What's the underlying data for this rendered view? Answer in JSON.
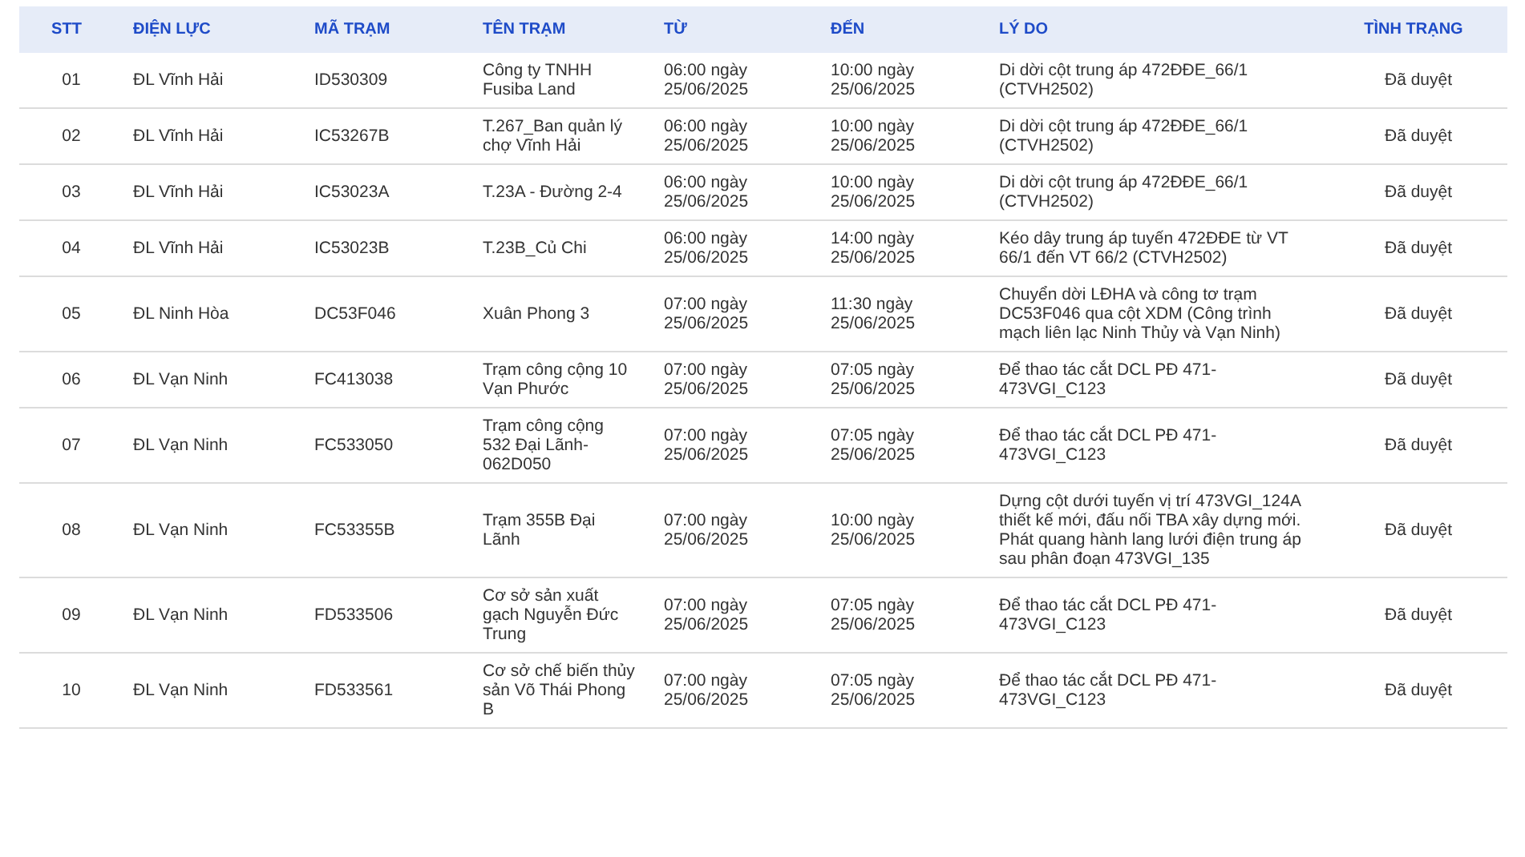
{
  "table": {
    "columns": [
      "STT",
      "ĐIỆN LỰC",
      "MÃ TRẠM",
      "TÊN TRẠM",
      "TỪ",
      "ĐẾN",
      "LÝ DO",
      "TÌNH TRẠNG"
    ],
    "rows": [
      {
        "stt": "01",
        "dien_luc": "ĐL Vĩnh Hải",
        "ma_tram": "ID530309",
        "ten_tram": "Công ty TNHH Fusiba Land",
        "tu": "06:00 ngày 25/06/2025",
        "den": "10:00 ngày 25/06/2025",
        "ly_do": "Di dời cột trung áp 472ĐĐE_66/1 (CTVH2502)",
        "tinh_trang": "Đã duyệt"
      },
      {
        "stt": "02",
        "dien_luc": "ĐL Vĩnh Hải",
        "ma_tram": "IC53267B",
        "ten_tram": "T.267_Ban quản lý chợ Vĩnh Hải",
        "tu": "06:00 ngày 25/06/2025",
        "den": "10:00 ngày 25/06/2025",
        "ly_do": "Di dời cột trung áp 472ĐĐE_66/1 (CTVH2502)",
        "tinh_trang": "Đã duyệt"
      },
      {
        "stt": "03",
        "dien_luc": "ĐL Vĩnh Hải",
        "ma_tram": "IC53023A",
        "ten_tram": "T.23A - Đường 2-4",
        "tu": "06:00 ngày 25/06/2025",
        "den": "10:00 ngày 25/06/2025",
        "ly_do": "Di dời cột trung áp 472ĐĐE_66/1 (CTVH2502)",
        "tinh_trang": "Đã duyệt"
      },
      {
        "stt": "04",
        "dien_luc": "ĐL Vĩnh Hải",
        "ma_tram": "IC53023B",
        "ten_tram": "T.23B_Củ Chi",
        "tu": "06:00 ngày 25/06/2025",
        "den": "14:00 ngày 25/06/2025",
        "ly_do": "Kéo dây trung áp tuyến 472ĐĐE từ VT 66/1 đến VT 66/2 (CTVH2502)",
        "tinh_trang": "Đã duyệt"
      },
      {
        "stt": "05",
        "dien_luc": "ĐL Ninh Hòa",
        "ma_tram": "DC53F046",
        "ten_tram": "Xuân Phong 3",
        "tu": "07:00 ngày 25/06/2025",
        "den": "11:30 ngày 25/06/2025",
        "ly_do": "Chuyển dời LĐHA và công tơ trạm DC53F046 qua cột XDM (Công trình mạch liên lạc Ninh Thủy và Vạn Ninh)",
        "tinh_trang": "Đã duyệt"
      },
      {
        "stt": "06",
        "dien_luc": "ĐL Vạn Ninh",
        "ma_tram": "FC413038",
        "ten_tram": "Trạm công cộng 10 Vạn Phước",
        "tu": "07:00 ngày 25/06/2025",
        "den": "07:05 ngày 25/06/2025",
        "ly_do": "Để thao tác cắt DCL PĐ 471-473VGI_C123",
        "tinh_trang": "Đã duyệt"
      },
      {
        "stt": "07",
        "dien_luc": "ĐL Vạn Ninh",
        "ma_tram": "FC533050",
        "ten_tram": "Trạm công cộng 532 Đại Lãnh-062D050",
        "tu": "07:00 ngày 25/06/2025",
        "den": "07:05 ngày 25/06/2025",
        "ly_do": "Để thao tác cắt DCL PĐ 471-473VGI_C123",
        "tinh_trang": "Đã duyệt"
      },
      {
        "stt": "08",
        "dien_luc": "ĐL Vạn Ninh",
        "ma_tram": "FC53355B",
        "ten_tram": "Trạm 355B Đại Lãnh",
        "tu": "07:00 ngày 25/06/2025",
        "den": "10:00 ngày 25/06/2025",
        "ly_do": "Dựng cột dưới tuyến vị trí 473VGI_124A thiết kế mới, đấu nối TBA xây dựng mới. Phát quang hành lang lưới điện trung áp sau phân đoạn 473VGI_135",
        "tinh_trang": "Đã duyệt"
      },
      {
        "stt": "09",
        "dien_luc": "ĐL Vạn Ninh",
        "ma_tram": "FD533506",
        "ten_tram": "Cơ sở sản xuất gạch Nguyễn Đức Trung",
        "tu": "07:00 ngày 25/06/2025",
        "den": "07:05 ngày 25/06/2025",
        "ly_do": "Để thao tác cắt DCL PĐ 471-473VGI_C123",
        "tinh_trang": "Đã duyệt"
      },
      {
        "stt": "10",
        "dien_luc": "ĐL Vạn Ninh",
        "ma_tram": "FD533561",
        "ten_tram": "Cơ sở chế biến thủy sản Võ Thái Phong B",
        "tu": "07:00 ngày 25/06/2025",
        "den": "07:05 ngày 25/06/2025",
        "ly_do": "Để thao tác cắt DCL PĐ 471-473VGI_C123",
        "tinh_trang": "Đã duyệt"
      }
    ]
  }
}
